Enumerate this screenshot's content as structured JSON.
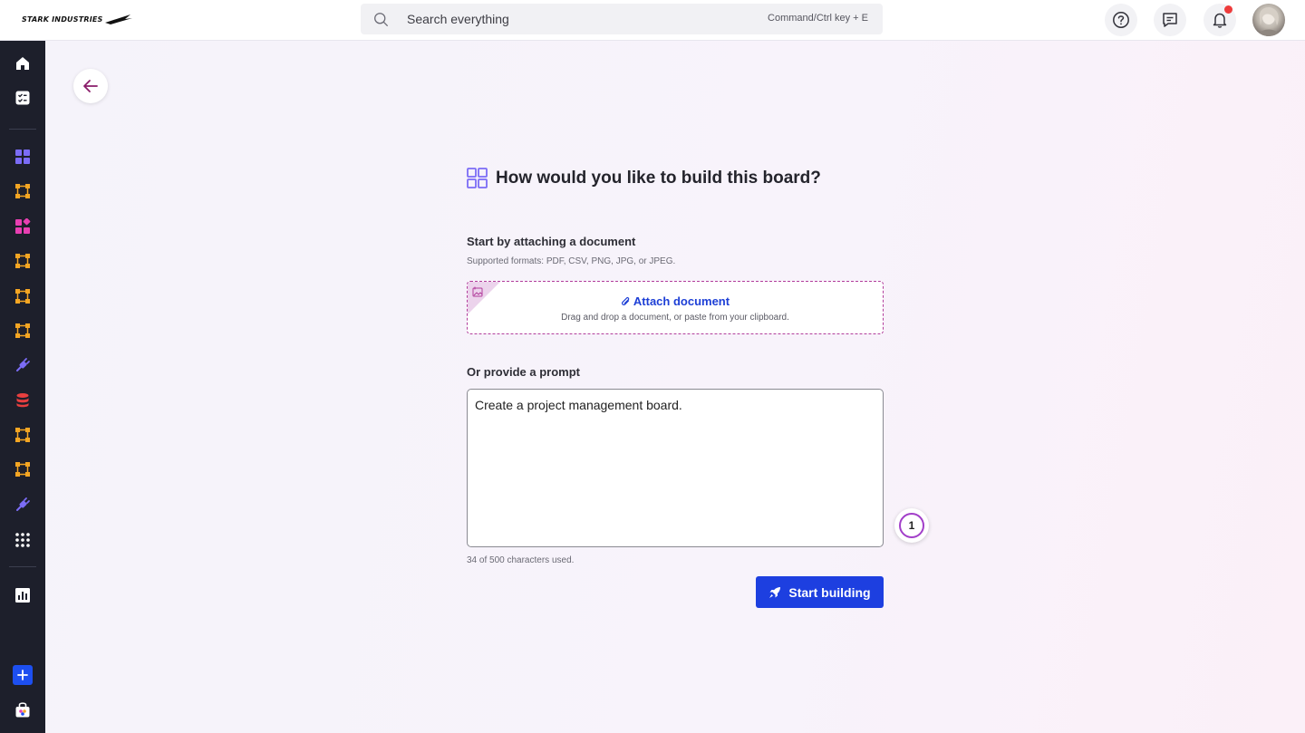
{
  "header": {
    "logo_text": "STARK INDUSTRIES",
    "search_placeholder": "Search everything",
    "search_shortcut": "Command/Ctrl key + E"
  },
  "sidebar": {
    "items": [
      {
        "name": "home-icon",
        "color": "#ffffff"
      },
      {
        "name": "tasks-icon",
        "color": "#ffffff"
      },
      {
        "name": "grid-icon",
        "color": "#7b6cf6"
      },
      {
        "name": "workflow-icon",
        "color": "#f5a623"
      },
      {
        "name": "widgets-icon",
        "color": "#e83fb2"
      },
      {
        "name": "workflow-icon",
        "color": "#f5a623"
      },
      {
        "name": "workflow-icon",
        "color": "#f5a623"
      },
      {
        "name": "workflow-icon",
        "color": "#f5a623"
      },
      {
        "name": "plug-icon",
        "color": "#7b6cf6"
      },
      {
        "name": "database-icon",
        "color": "#e83f3f"
      },
      {
        "name": "workflow-icon",
        "color": "#f5a623"
      },
      {
        "name": "workflow-icon",
        "color": "#f5a623"
      },
      {
        "name": "plug-icon",
        "color": "#7b6cf6"
      },
      {
        "name": "apps-icon",
        "color": "#ffffff"
      },
      {
        "name": "chart-icon",
        "color": "#ffffff"
      },
      {
        "name": "add-icon",
        "color": "#1d4ff0"
      },
      {
        "name": "store-icon",
        "color": "#ffffff"
      }
    ]
  },
  "page": {
    "title": "How would you like to build this board?",
    "attach_section_label": "Start by attaching a document",
    "attach_formats": "Supported formats: PDF, CSV, PNG, JPG, or JPEG.",
    "attach_button": "Attach document",
    "attach_hint": "Drag and drop a document, or paste from your clipboard.",
    "prompt_label": "Or provide a prompt",
    "prompt_value": "Create a project management board.",
    "char_counter": "34 of 500 characters used.",
    "step_number": "1",
    "start_button": "Start building"
  },
  "colors": {
    "accent_blue": "#1d3fe0",
    "accent_purple": "#a23fc9",
    "sidebar_bg": "#1d1f2b",
    "notification_dot": "#ee3b3b"
  }
}
